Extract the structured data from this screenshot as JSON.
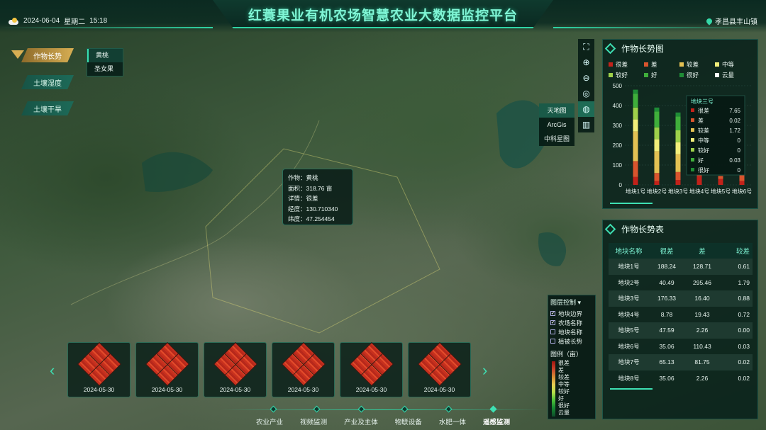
{
  "header": {
    "title": "红蓑果业有机农场智慧农业大数据监控平台",
    "date": "2024-06-04",
    "weekday": "星期二",
    "time": "15:18",
    "location": "孝昌县丰山镇"
  },
  "left_tabs": [
    "作物长势",
    "土壤湿度",
    "土壤干旱"
  ],
  "crop_menu": [
    "黄桃",
    "圣女果"
  ],
  "base_layers": [
    "天地图",
    "ArcGis",
    "中科星图"
  ],
  "popup": {
    "crop": "作物：黄桃",
    "area": "面积：318.76 亩",
    "detail": "详情：很差",
    "lon": "经度：130.710340",
    "lat": "纬度：47.254454"
  },
  "growth_panel": {
    "title": "作物长势图",
    "legend": [
      {
        "label": "很差",
        "color": "#c2221a"
      },
      {
        "label": "差",
        "color": "#d9542d"
      },
      {
        "label": "较差",
        "color": "#e3c153"
      },
      {
        "label": "中等",
        "color": "#f2ee7a"
      },
      {
        "label": "较好",
        "color": "#9ed04a"
      },
      {
        "label": "好",
        "color": "#3fae3b"
      },
      {
        "label": "很好",
        "color": "#1f8c36"
      },
      {
        "label": "云量",
        "color": "#ffffff"
      }
    ]
  },
  "chart_data": {
    "type": "bar",
    "categories": [
      "地块1号",
      "地块2号",
      "地块3号",
      "地块4号",
      "地块5号",
      "地块6号"
    ],
    "ylim": [
      0,
      500
    ],
    "yticks": [
      0,
      100,
      200,
      300,
      400,
      500
    ],
    "series": [
      {
        "name": "很差",
        "values": [
          40,
          20,
          25,
          45,
          30,
          20
        ]
      },
      {
        "name": "差",
        "values": [
          80,
          40,
          40,
          10,
          15,
          30
        ]
      },
      {
        "name": "较差",
        "values": [
          150,
          110,
          90,
          0,
          0,
          0
        ]
      },
      {
        "name": "中等",
        "values": [
          60,
          60,
          60,
          0,
          0,
          0
        ]
      },
      {
        "name": "较好",
        "values": [
          60,
          60,
          60,
          0,
          0,
          0
        ]
      },
      {
        "name": "好",
        "values": [
          70,
          80,
          70,
          0,
          0,
          0
        ]
      },
      {
        "name": "很好",
        "values": [
          20,
          20,
          20,
          0,
          0,
          0
        ]
      }
    ],
    "tooltip": {
      "title": "地块三号",
      "rows": [
        [
          "很差",
          "7.65"
        ],
        [
          "差",
          "0.02"
        ],
        [
          "较差",
          "1.72"
        ],
        [
          "中等",
          "0"
        ],
        [
          "较好",
          "0"
        ],
        [
          "好",
          "0.03"
        ],
        [
          "很好",
          "0"
        ]
      ]
    }
  },
  "table": {
    "title": "作物长势表",
    "headers": [
      "地块名称",
      "很差",
      "差",
      "较差"
    ],
    "rows": [
      [
        "地块1号",
        "188.24",
        "128.71",
        "0.61"
      ],
      [
        "地块2号",
        "40.49",
        "295.46",
        "1.79"
      ],
      [
        "地块3号",
        "176.33",
        "16.40",
        "0.88"
      ],
      [
        "地块4号",
        "8.78",
        "19.43",
        "0.72"
      ],
      [
        "地块5号",
        "47.59",
        "2.26",
        "0.00"
      ],
      [
        "地块6号",
        "35.06",
        "110.43",
        "0.03"
      ],
      [
        "地块7号",
        "65.13",
        "81.75",
        "0.02"
      ],
      [
        "地块8号",
        "35.06",
        "2.26",
        "0.02"
      ]
    ]
  },
  "layer_control": {
    "title": "图层控制",
    "items": [
      {
        "label": "地块边界",
        "checked": true
      },
      {
        "label": "农场名称",
        "checked": true
      },
      {
        "label": "地块名称",
        "checked": false
      },
      {
        "label": "植被长势",
        "checked": false
      }
    ],
    "legend_title": "图例（亩）",
    "legend_labels": [
      "很差",
      "差",
      "较差",
      "中等",
      "较好",
      "好",
      "很好",
      "云量"
    ]
  },
  "thumbnails": [
    "2024-05-30",
    "2024-05-30",
    "2024-05-30",
    "2024-05-30",
    "2024-05-30",
    "2024-05-30"
  ],
  "bottom_nav": [
    "农业产业",
    "视频监测",
    "产业及主体",
    "物联设备",
    "水肥一体",
    "遥感监测"
  ]
}
